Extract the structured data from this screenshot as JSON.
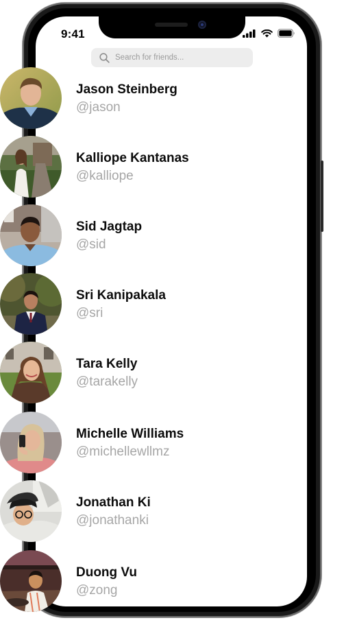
{
  "status_bar": {
    "time": "9:41",
    "icons": [
      "signal-icon",
      "wifi-icon",
      "battery-icon"
    ]
  },
  "search": {
    "placeholder": "Search for friends...",
    "value": "",
    "icon": "search-icon"
  },
  "friends": [
    {
      "name": "Jason Steinberg",
      "handle": "@jason"
    },
    {
      "name": "Kalliope Kantanas",
      "handle": "@kalliope"
    },
    {
      "name": "Sid Jagtap",
      "handle": "@sid"
    },
    {
      "name": "Sri Kanipakala",
      "handle": "@sri"
    },
    {
      "name": "Tara Kelly",
      "handle": "@tarakelly"
    },
    {
      "name": "Michelle Williams",
      "handle": "@michellewllmz"
    },
    {
      "name": "Jonathan Ki",
      "handle": "@jonathanki"
    },
    {
      "name": "Duong Vu",
      "handle": "@zong"
    }
  ],
  "colors": {
    "name_text": "#0c0c0c",
    "handle_text": "#a6a6a6",
    "search_bg": "#ededed",
    "device_frame": "#1a1a1a"
  }
}
